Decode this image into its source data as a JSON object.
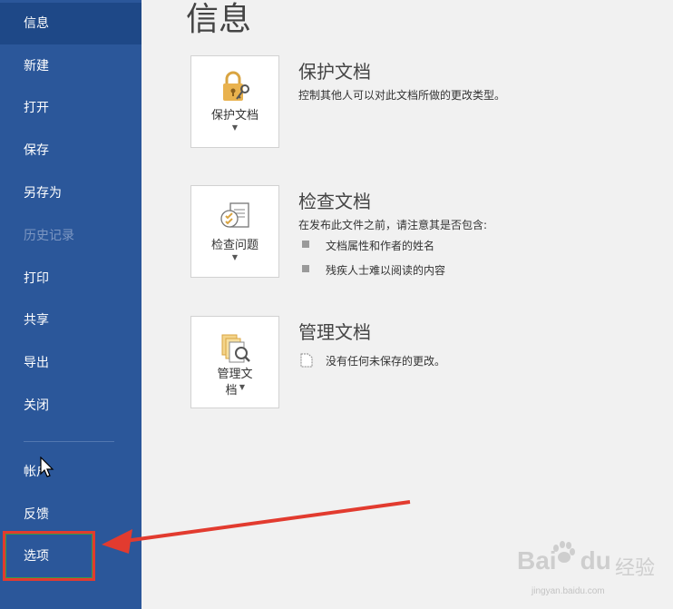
{
  "sidebar": {
    "items": [
      {
        "label": "信息"
      },
      {
        "label": "新建"
      },
      {
        "label": "打开"
      },
      {
        "label": "保存"
      },
      {
        "label": "另存为"
      },
      {
        "label": "历史记录"
      },
      {
        "label": "打印"
      },
      {
        "label": "共享"
      },
      {
        "label": "导出"
      },
      {
        "label": "关闭"
      },
      {
        "label": "帐户"
      },
      {
        "label": "反馈"
      },
      {
        "label": "选项"
      }
    ]
  },
  "main": {
    "title": "信息",
    "protect": {
      "button_label": "保护文档",
      "title": "保护文档",
      "description": "控制其他人可以对此文档所做的更改类型。"
    },
    "inspect": {
      "button_label": "检查问题",
      "title": "检查文档",
      "description": "在发布此文件之前，请注意其是否包含:",
      "bullets": [
        "文档属性和作者的姓名",
        "残疾人士难以阅读的内容"
      ]
    },
    "manage": {
      "button_label_line1": "管理文",
      "button_label_line2": "档",
      "title": "管理文档",
      "description": "没有任何未保存的更改。"
    }
  },
  "watermark": {
    "brand": "Bai",
    "brand_suffix": "du",
    "cn": "经验",
    "url": "jingyan.baidu.com"
  },
  "colors": {
    "sidebar": "#2b579a",
    "sidebar_active": "#1e4887",
    "highlight": "#e23b2f"
  }
}
